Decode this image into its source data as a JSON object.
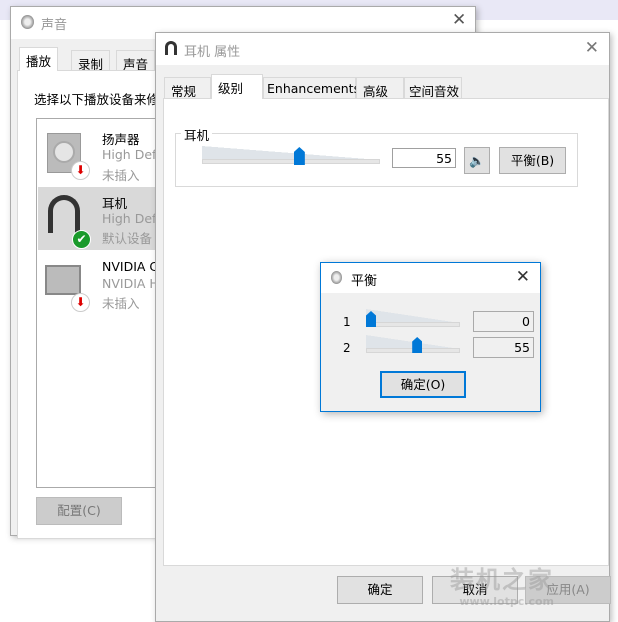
{
  "sound_window": {
    "title": "声音",
    "tabs": [
      "播放",
      "录制",
      "声音"
    ],
    "instruction": "选择以下播放设备来修",
    "devices": [
      {
        "name": "扬声器",
        "driver": "High Def",
        "status": "未插入",
        "icon": "speaker-icon",
        "badge": "unplugged"
      },
      {
        "name": "耳机",
        "driver": "High Def",
        "status": "默认设备",
        "icon": "headphones-icon",
        "badge": "default"
      },
      {
        "name": "NVIDIA C",
        "driver": "NVIDIA H",
        "status": "未插入",
        "icon": "monitor-icon",
        "badge": "unplugged"
      }
    ],
    "configure_label": "配置(C)"
  },
  "props_window": {
    "title": "耳机 属性",
    "tabs": [
      "常规",
      "级别",
      "Enhancements",
      "高级",
      "空间音效"
    ],
    "active_tab": "级别",
    "group_label": "耳机",
    "volume": 55,
    "volume_text": "55",
    "balance_label": "平衡(B)",
    "ok_label": "确定",
    "cancel_label": "取消",
    "apply_label": "应用(A)"
  },
  "balance_dialog": {
    "title": "平衡",
    "channels": [
      {
        "label": "1",
        "value": 0,
        "text": "0"
      },
      {
        "label": "2",
        "value": 55,
        "text": "55"
      }
    ],
    "ok_label": "确定(O)"
  },
  "watermark": {
    "text": "装机之家",
    "url": "www.lotpc.com"
  }
}
